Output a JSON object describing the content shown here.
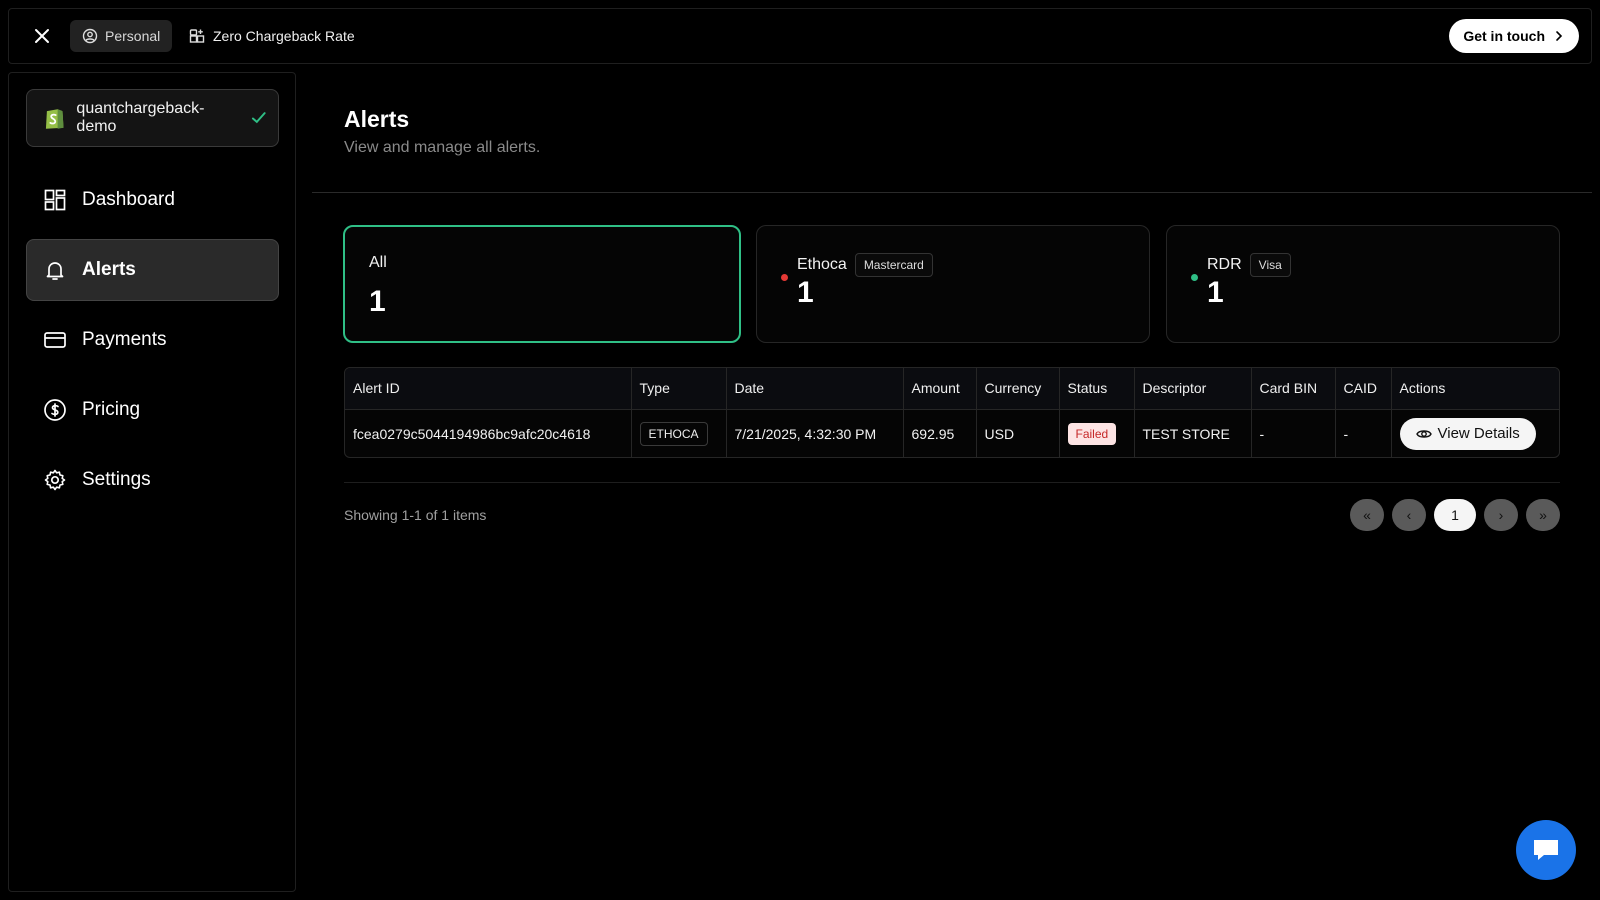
{
  "topbar": {
    "personal_label": "Personal",
    "zcr_label": "Zero Chargeback Rate",
    "cta_label": "Get in touch"
  },
  "sidebar": {
    "store_name": "quantchargeback-demo",
    "items": [
      {
        "label": "Dashboard",
        "icon": "dashboard-icon",
        "active": false
      },
      {
        "label": "Alerts",
        "icon": "bell-icon",
        "active": true
      },
      {
        "label": "Payments",
        "icon": "credit-card-icon",
        "active": false
      },
      {
        "label": "Pricing",
        "icon": "dollar-circle-icon",
        "active": false
      },
      {
        "label": "Settings",
        "icon": "gear-icon",
        "active": false
      }
    ]
  },
  "page": {
    "title": "Alerts",
    "subtitle": "View and manage all alerts."
  },
  "cards": {
    "all": {
      "label": "All",
      "count": "1"
    },
    "ethoca": {
      "label": "Ethoca",
      "tag": "Mastercard",
      "count": "1",
      "dot_color": "#e53935"
    },
    "rdr": {
      "label": "RDR",
      "tag": "Visa",
      "count": "1",
      "dot_color": "#2fbf86"
    }
  },
  "table": {
    "headers": [
      "Alert ID",
      "Type",
      "Date",
      "Amount",
      "Currency",
      "Status",
      "Descriptor",
      "Card BIN",
      "CAID",
      "Actions"
    ],
    "rows": [
      {
        "alert_id": "fcea0279c5044194986bc9afc20c4618",
        "type": "ETHOCA",
        "date": "7/21/2025, 4:32:30 PM",
        "amount": "692.95",
        "currency": "USD",
        "status": "Failed",
        "descriptor": "TEST STORE",
        "card_bin": "-",
        "caid": "-",
        "action_label": "View Details"
      }
    ]
  },
  "pagination": {
    "showing": "Showing 1-1 of 1 items",
    "first": "«",
    "prev": "‹",
    "current": "1",
    "next": "›",
    "last": "»"
  },
  "colors": {
    "accent": "#2fbf86",
    "danger": "#e53935",
    "chat": "#1a73e8"
  }
}
